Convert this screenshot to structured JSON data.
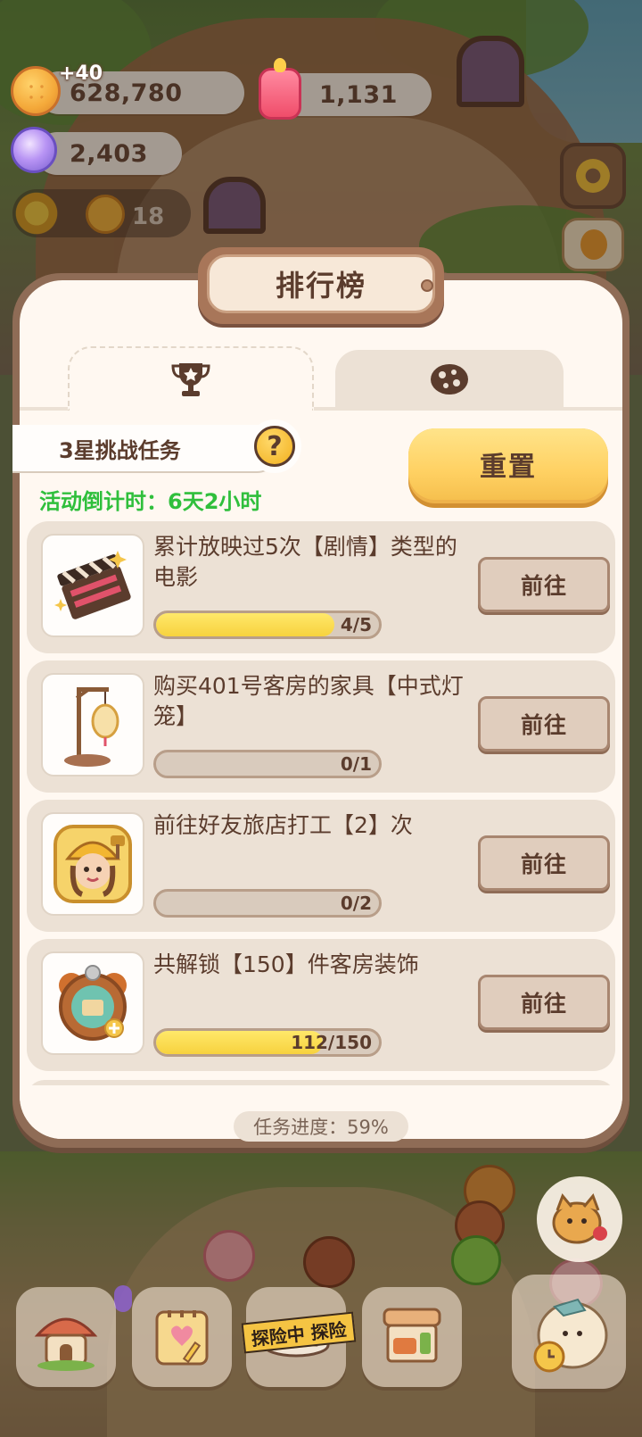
{
  "hud": {
    "coins": "628,780",
    "coins_gain": "+40",
    "candles": "1,131",
    "gems": "2,403",
    "side_count": "18"
  },
  "panel": {
    "title": "排行榜",
    "tabs": [
      {
        "icon": "trophy-icon",
        "active": true
      },
      {
        "icon": "cookie-icon",
        "active": false
      }
    ],
    "event_name": "3星挑战任务",
    "help_label": "?",
    "countdown_label": "活动倒计时：",
    "countdown_value": "6天2小时",
    "reset_label": "重置",
    "tasks": [
      {
        "text": "累计放映过5次【剧情】类型的电影",
        "progress": "4/5",
        "fraction": 0.8,
        "button": "前往",
        "icon": "clapperboard-icon"
      },
      {
        "text": "购买401号客房的家具【中式灯笼】",
        "progress": "0/1",
        "fraction": 0.0,
        "button": "前往",
        "icon": "lantern-icon"
      },
      {
        "text": "前往好友旅店打工【2】次",
        "progress": "0/2",
        "fraction": 0.0,
        "button": "前往",
        "icon": "worker-avatar-icon"
      },
      {
        "text": "共解锁【150】件客房装饰",
        "progress": "112/150",
        "fraction": 0.7467,
        "button": "前往",
        "icon": "decor-badge-icon"
      }
    ],
    "overall_progress": "任务进度：59%"
  },
  "dock": {
    "explore_tape": "探险中 探险"
  },
  "colors": {
    "accent_yellow": "#ffd163",
    "countdown_green": "#2fbf3c",
    "text_brown": "#5b3c2d",
    "panel_bg": "#fff8f1",
    "card_bg": "#ece1d5"
  }
}
